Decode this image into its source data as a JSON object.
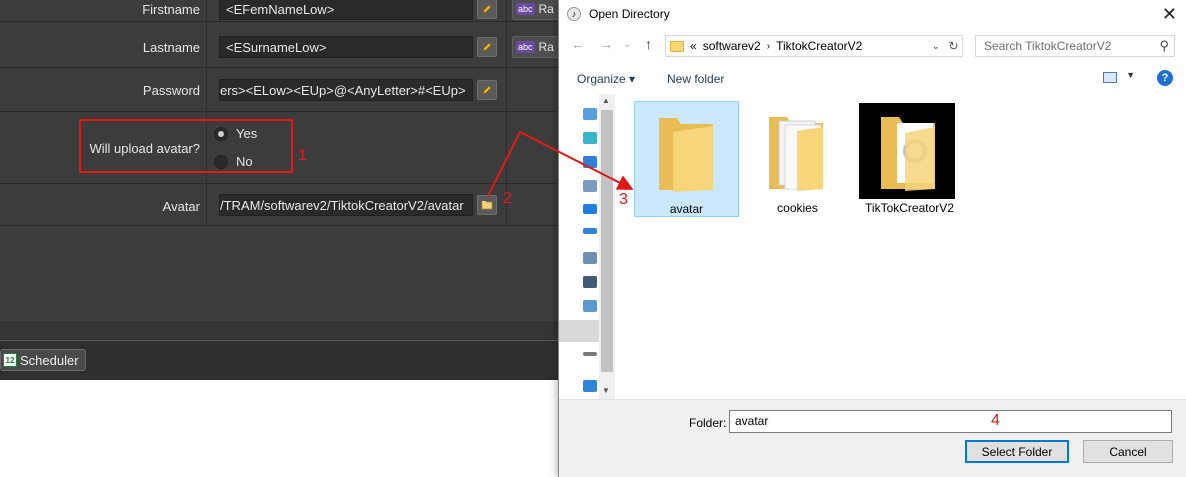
{
  "form": {
    "rows": [
      {
        "label": "Firstname",
        "value": "<EFemNameLow>",
        "random_label": "Ra"
      },
      {
        "label": "Lastname",
        "value": "<ESurnameLow>",
        "random_label": "Ra"
      },
      {
        "label": "Password",
        "value": "ers><ELow><EUp>@<AnyLetter>#<EUp>"
      },
      {
        "label": "Will upload avatar?",
        "options": [
          "Yes",
          "No"
        ],
        "selected": "Yes"
      },
      {
        "label": "Avatar",
        "value": "/TRAM/softwarev2/TiktokCreatorV2/avatar"
      }
    ],
    "abc_badge": "abc"
  },
  "scheduler": {
    "label": "Scheduler",
    "icon_text": "12"
  },
  "annotations": [
    "1",
    "2",
    "3",
    "4"
  ],
  "colors": {
    "annotation": "#e01818",
    "dialog_accent": "#0078d7"
  },
  "dialog": {
    "title": "Open Directory",
    "breadcrumb": [
      "softwarev2",
      "TiktokCreatorV2"
    ],
    "breadcrumb_prefix": "«",
    "search_placeholder": "Search TiktokCreatorV2",
    "toolbar": {
      "organize": "Organize ▾",
      "new_folder": "New folder"
    },
    "items": [
      {
        "name": "avatar",
        "selected": true
      },
      {
        "name": "cookies",
        "selected": false
      },
      {
        "name": "TikTokCreatorV2",
        "selected": false
      }
    ],
    "folder_label": "Folder:",
    "folder_value": "avatar",
    "select_button": "Select Folder",
    "cancel_button": "Cancel"
  }
}
